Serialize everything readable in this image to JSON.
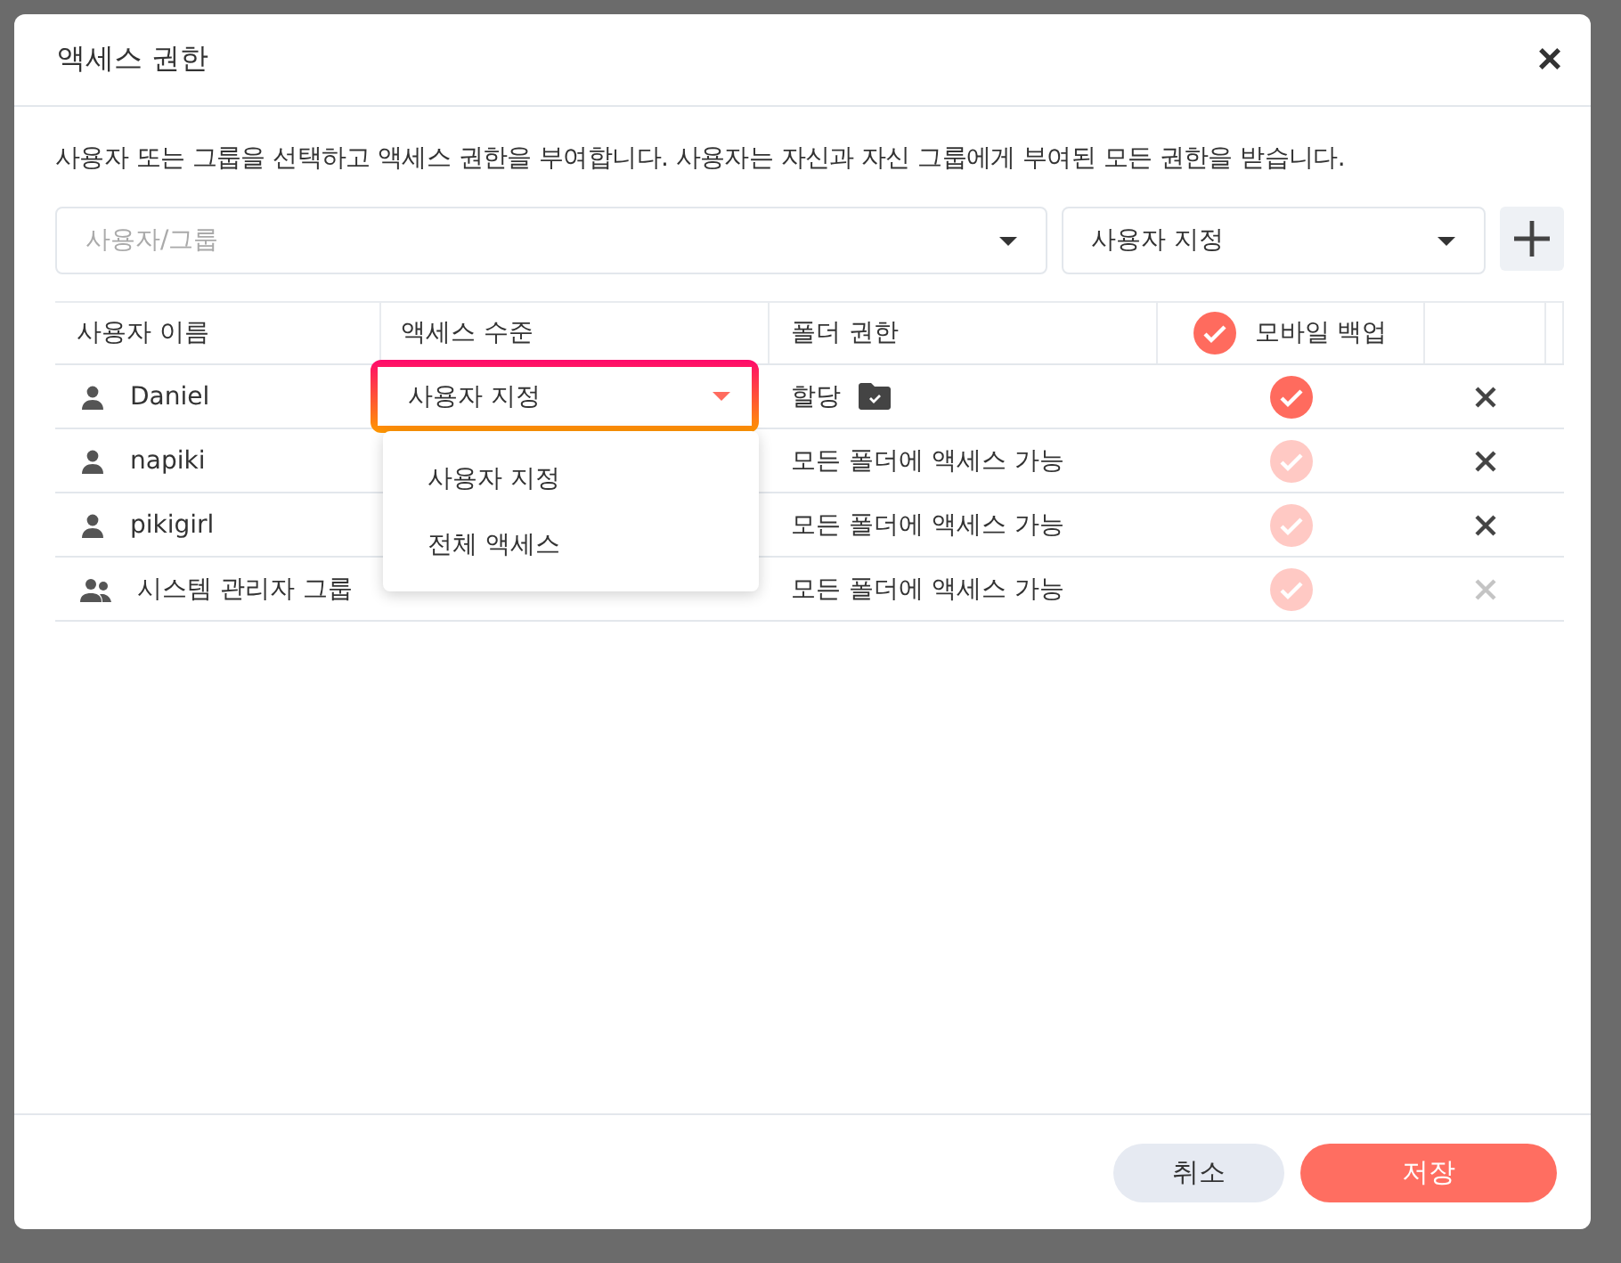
{
  "dialog": {
    "title": "액세스 권한",
    "close": "×"
  },
  "description": "사용자 또는 그룹을 선택하고 액세스 권한을 부여합니다. 사용자는 자신과 자신 그룹에게 부여된 모든 권한을 받습니다.",
  "user_select": {
    "placeholder": "사용자/그룹"
  },
  "level_select": {
    "value": "사용자 지정"
  },
  "table": {
    "columns": [
      "사용자 이름",
      "액세스 수준",
      "폴더 권한",
      "모바일 백업"
    ],
    "rows": [
      {
        "kind": "user",
        "name": "Daniel",
        "access_level": "사용자 지정",
        "folder_permission": "할당",
        "folder_icon": true,
        "mobile_backup": {
          "checked": true,
          "disabled": false
        },
        "remove_disabled": false
      },
      {
        "kind": "user",
        "name": "napiki",
        "folder_permission": "모든 폴더에 액세스 가능",
        "folder_icon": false,
        "mobile_backup": {
          "checked": true,
          "disabled": true
        },
        "remove_disabled": false
      },
      {
        "kind": "user",
        "name": "pikigirl",
        "folder_permission": "모든 폴더에 액세스 가능",
        "folder_icon": false,
        "mobile_backup": {
          "checked": true,
          "disabled": true
        },
        "remove_disabled": false
      },
      {
        "kind": "group",
        "name": "시스템 관리자 그룹",
        "folder_permission": "모든 폴더에 액세스 가능",
        "folder_icon": false,
        "mobile_backup": {
          "checked": true,
          "disabled": true
        },
        "remove_disabled": true
      }
    ]
  },
  "dropdown_menu": {
    "items": [
      "사용자 지정",
      "전체 액세스"
    ]
  },
  "buttons": [
    {
      "label": "취소",
      "kind": "secondary"
    },
    {
      "label": "저장",
      "kind": "primary"
    }
  ]
}
